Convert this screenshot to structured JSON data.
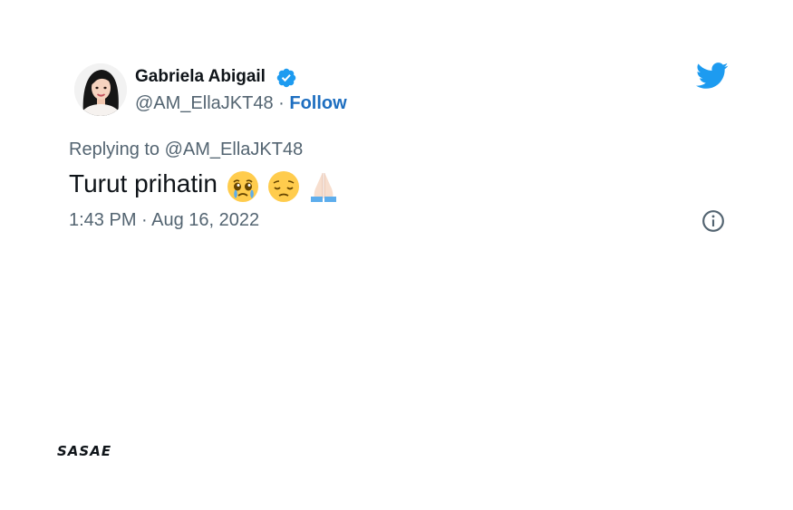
{
  "tweet": {
    "author": {
      "name": "Gabriela Abigail",
      "handle": "@AM_EllaJKT48",
      "separator": "·",
      "follow_label": "Follow",
      "verified_icon": "verified-badge-icon",
      "avatar": "profile-photo"
    },
    "replying_to_prefix": "Replying to",
    "replying_to_handle": "@AM_EllaJKT48",
    "text": "Turut prihatin",
    "emojis": [
      "crying-face-emoji",
      "pensive-face-emoji",
      "folded-hands-emoji"
    ],
    "timestamp": "1:43 PM · Aug 16, 2022",
    "platform_icon": "twitter-bird-icon",
    "info_icon": "info-icon"
  },
  "watermark": {
    "text": "SASAE"
  },
  "colors": {
    "text_primary": "#0f1419",
    "text_secondary": "#536471",
    "link": "#1d6ec0",
    "twitter_blue": "#1d9bf0"
  }
}
